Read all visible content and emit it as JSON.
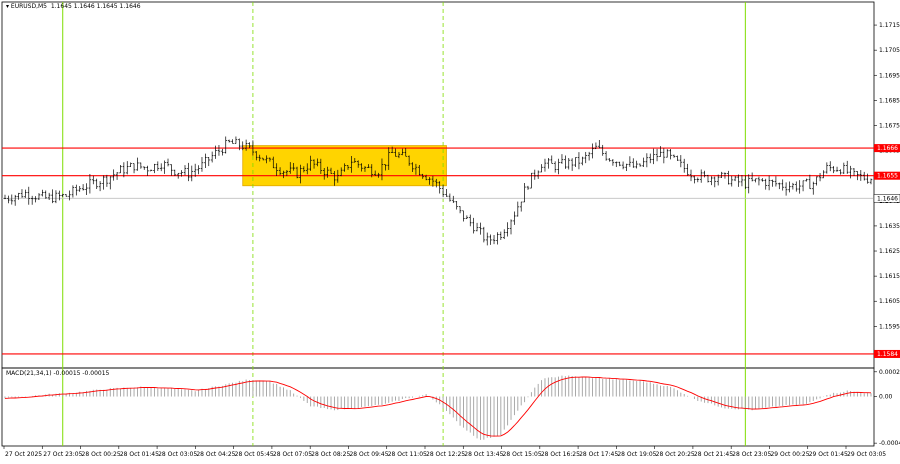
{
  "header": {
    "symbol": "EURUSD,M5",
    "ohlc": "1.1645 1.1646 1.1645 1.1646"
  },
  "macd_header": {
    "title": "MACD(21,34,1)",
    "values": "-0.00015 -0.00015"
  },
  "colors": {
    "background": "#ffffff",
    "candles": "#000000",
    "resistance": "#ff0000",
    "zone": "#ffd400",
    "zone_border": "#e0a800",
    "session_line_solid": "#7fdd00",
    "session_line_dashed": "#7fdd00",
    "macd_signal": "#ff0000",
    "macd_hist": "#a0a0a0",
    "current_price_line": "#c0c0c0"
  },
  "chart_data": [
    {
      "type": "candlestick",
      "instrument": "EURUSD",
      "timeframe": "M5",
      "price_axis": [
        "1.1715",
        "1.1705",
        "1.1695",
        "1.1685",
        "1.1675",
        "1.1665",
        "1.1655",
        "1.1645",
        "1.1635",
        "1.1625",
        "1.1615",
        "1.1605",
        "1.1595",
        "1.1584"
      ],
      "ylim": [
        1.158,
        1.1721
      ],
      "time_labels": [
        "27 Oct 2025",
        "27 Oct 23:05",
        "28 Oct 00:25",
        "28 Oct 01:45",
        "28 Oct 03:05",
        "28 Oct 04:25",
        "28 Oct 05:45",
        "28 Oct 07:05",
        "28 Oct 08:25",
        "28 Oct 09:45",
        "28 Oct 11:05",
        "28 Oct 12:25",
        "28 Oct 13:45",
        "28 Oct 15:05",
        "28 Oct 16:25",
        "28 Oct 17:45",
        "28 Oct 19:05",
        "28 Oct 20:25",
        "28 Oct 21:45",
        "28 Oct 23:05",
        "29 Oct 00:25",
        "29 Oct 01:45",
        "29 Oct 03:05"
      ],
      "price_path": [
        [
          0,
          1.1646
        ],
        [
          6,
          1.1648
        ],
        [
          12,
          1.1646
        ],
        [
          18,
          1.1647
        ],
        [
          22,
          1.165
        ],
        [
          26,
          1.1652
        ],
        [
          30,
          1.1654
        ],
        [
          34,
          1.1657
        ],
        [
          38,
          1.1659
        ],
        [
          42,
          1.1658
        ],
        [
          46,
          1.166
        ],
        [
          50,
          1.1657
        ],
        [
          54,
          1.1656
        ],
        [
          58,
          1.1659
        ],
        [
          62,
          1.1664
        ],
        [
          66,
          1.1668
        ],
        [
          70,
          1.1667
        ],
        [
          74,
          1.1664
        ],
        [
          78,
          1.166
        ],
        [
          82,
          1.1657
        ],
        [
          86,
          1.1656
        ],
        [
          90,
          1.166
        ],
        [
          94,
          1.1657
        ],
        [
          98,
          1.1654
        ],
        [
          102,
          1.1661
        ],
        [
          106,
          1.1658
        ],
        [
          110,
          1.1657
        ],
        [
          114,
          1.1664
        ],
        [
          118,
          1.1662
        ],
        [
          122,
          1.1657
        ],
        [
          126,
          1.1653
        ],
        [
          130,
          1.1647
        ],
        [
          134,
          1.164
        ],
        [
          138,
          1.1635
        ],
        [
          142,
          1.1629
        ],
        [
          146,
          1.1632
        ],
        [
          150,
          1.164
        ],
        [
          154,
          1.1652
        ],
        [
          158,
          1.166
        ],
        [
          162,
          1.1659
        ],
        [
          166,
          1.166
        ],
        [
          170,
          1.1661
        ],
        [
          174,
          1.1666
        ],
        [
          178,
          1.1662
        ],
        [
          182,
          1.166
        ],
        [
          186,
          1.1658
        ],
        [
          190,
          1.1662
        ],
        [
          194,
          1.1664
        ],
        [
          198,
          1.166
        ],
        [
          202,
          1.1656
        ],
        [
          206,
          1.1654
        ],
        [
          210,
          1.1655
        ],
        [
          214,
          1.1653
        ],
        [
          218,
          1.1652
        ],
        [
          222,
          1.1653
        ],
        [
          226,
          1.1652
        ],
        [
          230,
          1.1651
        ],
        [
          234,
          1.1651
        ],
        [
          238,
          1.1652
        ],
        [
          242,
          1.1658
        ],
        [
          246,
          1.1658
        ],
        [
          250,
          1.1655
        ],
        [
          254,
          1.1654
        ]
      ],
      "levels": [
        {
          "price": 1.1666,
          "label": "1.1666"
        },
        {
          "price": 1.1655,
          "label": "1.1655"
        },
        {
          "price": 1.1584,
          "label": "1.1584"
        }
      ],
      "current_price": {
        "price": 1.1646,
        "label": "1.1646"
      },
      "zone": {
        "x_start": 70,
        "x_end": 130,
        "price_top": 1.1667,
        "price_bottom": 1.1651
      },
      "vlines": [
        {
          "x": 17,
          "style": "solid"
        },
        {
          "x": 73,
          "style": "dashed"
        },
        {
          "x": 129,
          "style": "dashed"
        },
        {
          "x": 218,
          "style": "solid"
        }
      ],
      "bars_total": 256
    },
    {
      "type": "bar",
      "name": "MACD(21,34,1)",
      "axis_labels": [
        "0.00026",
        "0.00",
        "-0.00049"
      ],
      "ylim": [
        -0.00052,
        0.0003
      ],
      "hist_path": [
        [
          0,
          -2e-05
        ],
        [
          12,
          2e-05
        ],
        [
          20,
          4e-05
        ],
        [
          30,
          8e-05
        ],
        [
          40,
          0.0001
        ],
        [
          46,
          9e-05
        ],
        [
          56,
          6e-05
        ],
        [
          64,
          0.00012
        ],
        [
          72,
          0.00018
        ],
        [
          78,
          0.00016
        ],
        [
          84,
          6e-05
        ],
        [
          90,
          -0.0001
        ],
        [
          96,
          -0.00014
        ],
        [
          104,
          -0.00012
        ],
        [
          112,
          -8e-05
        ],
        [
          118,
          -2e-05
        ],
        [
          124,
          2e-05
        ],
        [
          128,
          -8e-05
        ],
        [
          134,
          -0.0003
        ],
        [
          140,
          -0.00046
        ],
        [
          146,
          -0.0004
        ],
        [
          152,
          -0.0001
        ],
        [
          158,
          0.00018
        ],
        [
          164,
          0.00022
        ],
        [
          172,
          0.0002
        ],
        [
          180,
          0.00018
        ],
        [
          188,
          0.00016
        ],
        [
          196,
          0.0001
        ],
        [
          204,
          -4e-05
        ],
        [
          212,
          -0.00012
        ],
        [
          220,
          -0.00014
        ],
        [
          228,
          -0.0001
        ],
        [
          236,
          -8e-05
        ],
        [
          242,
          2e-05
        ],
        [
          248,
          6e-05
        ],
        [
          255,
          3e-05
        ]
      ]
    }
  ]
}
